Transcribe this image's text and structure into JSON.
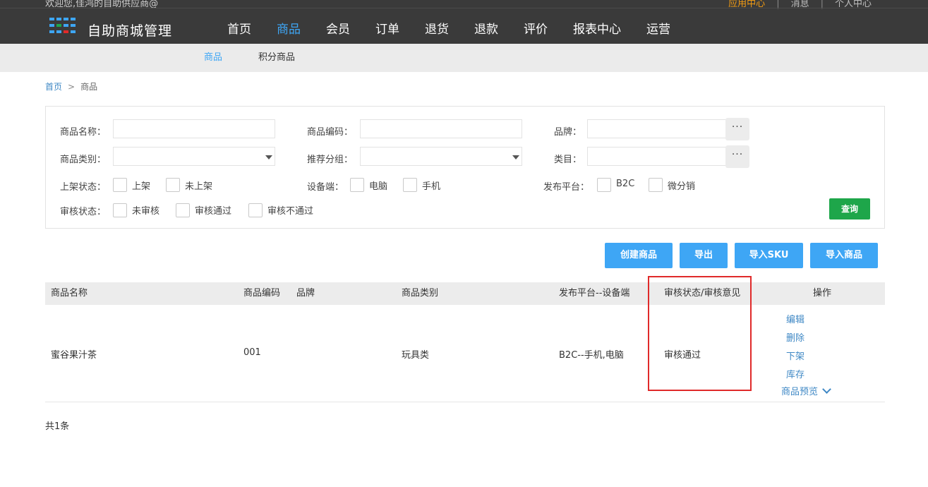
{
  "topbar": {
    "welcome": "欢迎您,佳鸿的自助供应商@",
    "links": [
      "应用中心",
      "消息",
      "个人中心"
    ],
    "brand": "自助商城管理",
    "logo_colors": [
      "#3ea6f5",
      "#1ea64a",
      "#e02a2a"
    ]
  },
  "mainnav": {
    "items": [
      "首页",
      "商品",
      "会员",
      "订单",
      "退货",
      "退款",
      "评价",
      "报表中心",
      "运营"
    ],
    "active": "商品"
  },
  "subnav": {
    "items": [
      "商品",
      "积分商品"
    ],
    "active": "商品"
  },
  "breadcrumb": {
    "home": "首页",
    "sep": ">",
    "current": "商品"
  },
  "filter": {
    "name_label": "商品名称：",
    "code_label": "商品编码：",
    "brand_label": "品牌：",
    "category_label": "商品类别：",
    "group_label": "推荐分组：",
    "type_label": "类目：",
    "dots": "···",
    "shelf_label": "上架状态：",
    "shelf_opts": [
      "上架",
      "未上架"
    ],
    "device_label": "设备端：",
    "device_opts": [
      "电脑",
      "手机"
    ],
    "platform_label": "发布平台：",
    "platform_opts": [
      "B2C",
      "微分销"
    ],
    "audit_label": "审核状态：",
    "audit_opts": [
      "未审核",
      "审核通过",
      "审核不通过"
    ],
    "query": "查询"
  },
  "actions": [
    "创建商品",
    "导出",
    "导入SKU",
    "导入商品"
  ],
  "table": {
    "headers": [
      "商品名称",
      "商品编码",
      "品牌",
      "商品类别",
      "发布平台--设备端",
      "审核状态/审核意见",
      "操作"
    ],
    "rows": [
      {
        "name": "蜜谷果汁茶",
        "code": "001",
        "brand": "",
        "category": "玩具类",
        "platform": "B2C--手机,电脑",
        "audit": "审核通过",
        "ops": [
          "编辑",
          "删除",
          "下架",
          "库存",
          "商品预览"
        ]
      }
    ]
  },
  "total": "共1条",
  "colors": {
    "accent": "#3ea6f5",
    "query": "#1ea64a",
    "highlight": "#e02a2a",
    "topbar": "#3a3a3a"
  }
}
